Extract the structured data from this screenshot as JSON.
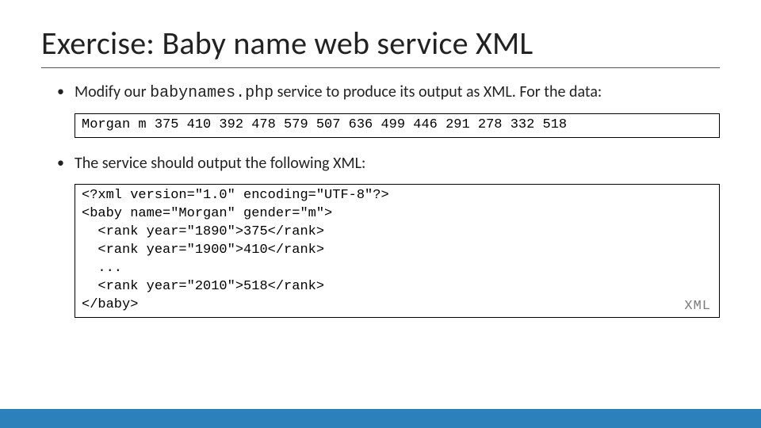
{
  "title": "Exercise: Baby name web service XML",
  "bullet1": {
    "pre": "Modify our ",
    "mono": "babynames.php",
    "post": " service to produce its output as XML. For the data:"
  },
  "code1": "Morgan m 375 410 392 478 579 507 636 499 446 291 278 332 518",
  "bullet2": "The service should output the following XML:",
  "code2": "<?xml version=\"1.0\" encoding=\"UTF-8\"?>\n<baby name=\"Morgan\" gender=\"m\">\n  <rank year=\"1890\">375</rank>\n  <rank year=\"1900\">410</rank>\n  ...\n  <rank year=\"2010\">518</rank>\n</baby>",
  "xml_label": "XML",
  "accent_color": "#2c81ba"
}
